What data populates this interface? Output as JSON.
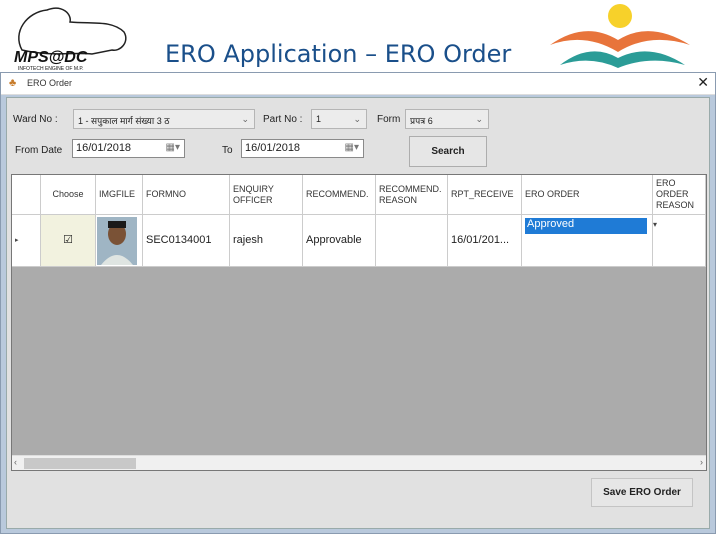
{
  "slide": {
    "title": "ERO Application – ERO Order",
    "logo_text": "MPS@DC",
    "logo_sub": "INFOTECH ENGINE OF M.P."
  },
  "window": {
    "title": "ERO Order",
    "close_icon": "close-icon"
  },
  "filters": {
    "ward_label": "Ward No :",
    "ward_value": "1 - सपुकाल मार्ग संख्या 3 ठ",
    "part_label": "Part No :",
    "part_value": "1",
    "form_label": "Form",
    "form_value": "प्रपत्र 6",
    "from_label": "From Date",
    "from_value": "16/01/2018",
    "to_label": "To",
    "to_value": "16/01/2018",
    "search_label": "Search"
  },
  "grid": {
    "columns": [
      "",
      "Choose",
      "IMGFILE",
      "FORMNO",
      "ENQUIRY OFFICER",
      "RECOMMEND.",
      "RECOMMEND. REASON",
      "RPT_RECEIVE",
      "ERO ORDER",
      "ERO ORDER REASON"
    ],
    "rows": [
      {
        "choose": "☑",
        "formno": "SEC0134001",
        "officer": "rajesh",
        "recommend": "Approvable",
        "reason": "",
        "rpt": "16/01/201...",
        "ero_order": "Approved",
        "ero_reason": ""
      }
    ]
  },
  "save_label": "Save ERO Order"
}
